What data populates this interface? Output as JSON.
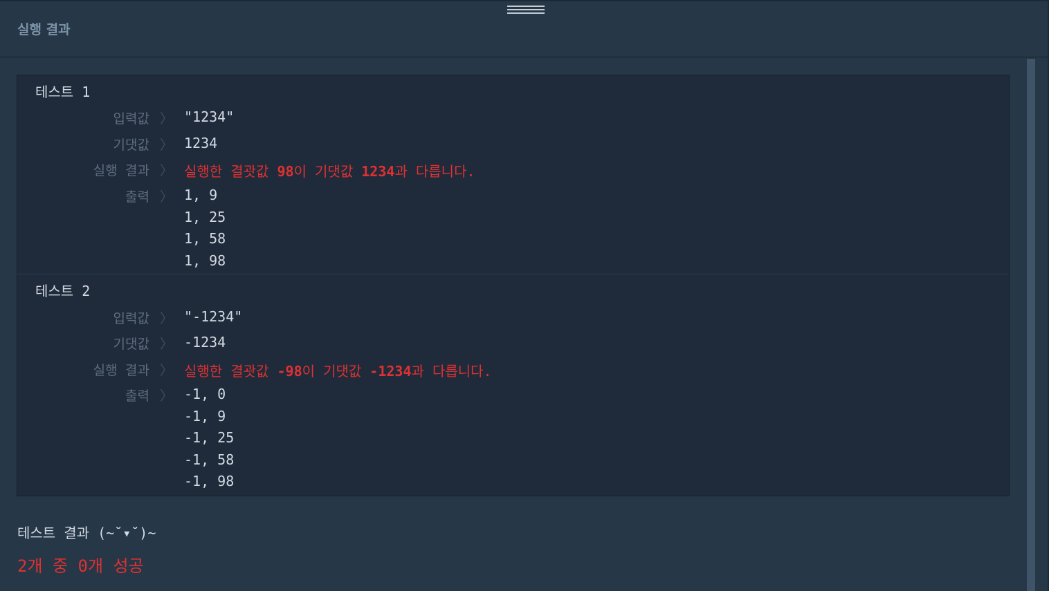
{
  "header": {
    "title": "실행 결과"
  },
  "labels": {
    "input": "입력값",
    "expected": "기댓값",
    "result": "실행 결과",
    "output": "출력",
    "arrow": "〉"
  },
  "tests": [
    {
      "title": "테스트 1",
      "input": "\"1234\"",
      "expected": "1234",
      "result": {
        "prefix": "실행한 결괏값 ",
        "actual": "98",
        "mid": "이 기댓값 ",
        "expected": "1234",
        "suffix": "과 다릅니다."
      },
      "output": [
        "1, 9",
        "1, 25",
        "1, 58",
        "1, 98"
      ]
    },
    {
      "title": "테스트 2",
      "input": "\"-1234\"",
      "expected": "-1234",
      "result": {
        "prefix": "실행한 결괏값 ",
        "actual": "-98",
        "mid": "이 기댓값 ",
        "expected": "-1234",
        "suffix": "과 다릅니다."
      },
      "output": [
        "-1, 0",
        "-1, 9",
        "-1, 25",
        "-1, 58",
        "-1, 98"
      ]
    }
  ],
  "summary": {
    "title": "테스트 결과 (~˘▾˘)~",
    "result": "2개 중 0개 성공"
  },
  "colors": {
    "background": "#263747",
    "panel": "#1f2b3b",
    "error": "#e03131",
    "text": "#d3dae2",
    "label": "#5d6e7f"
  }
}
